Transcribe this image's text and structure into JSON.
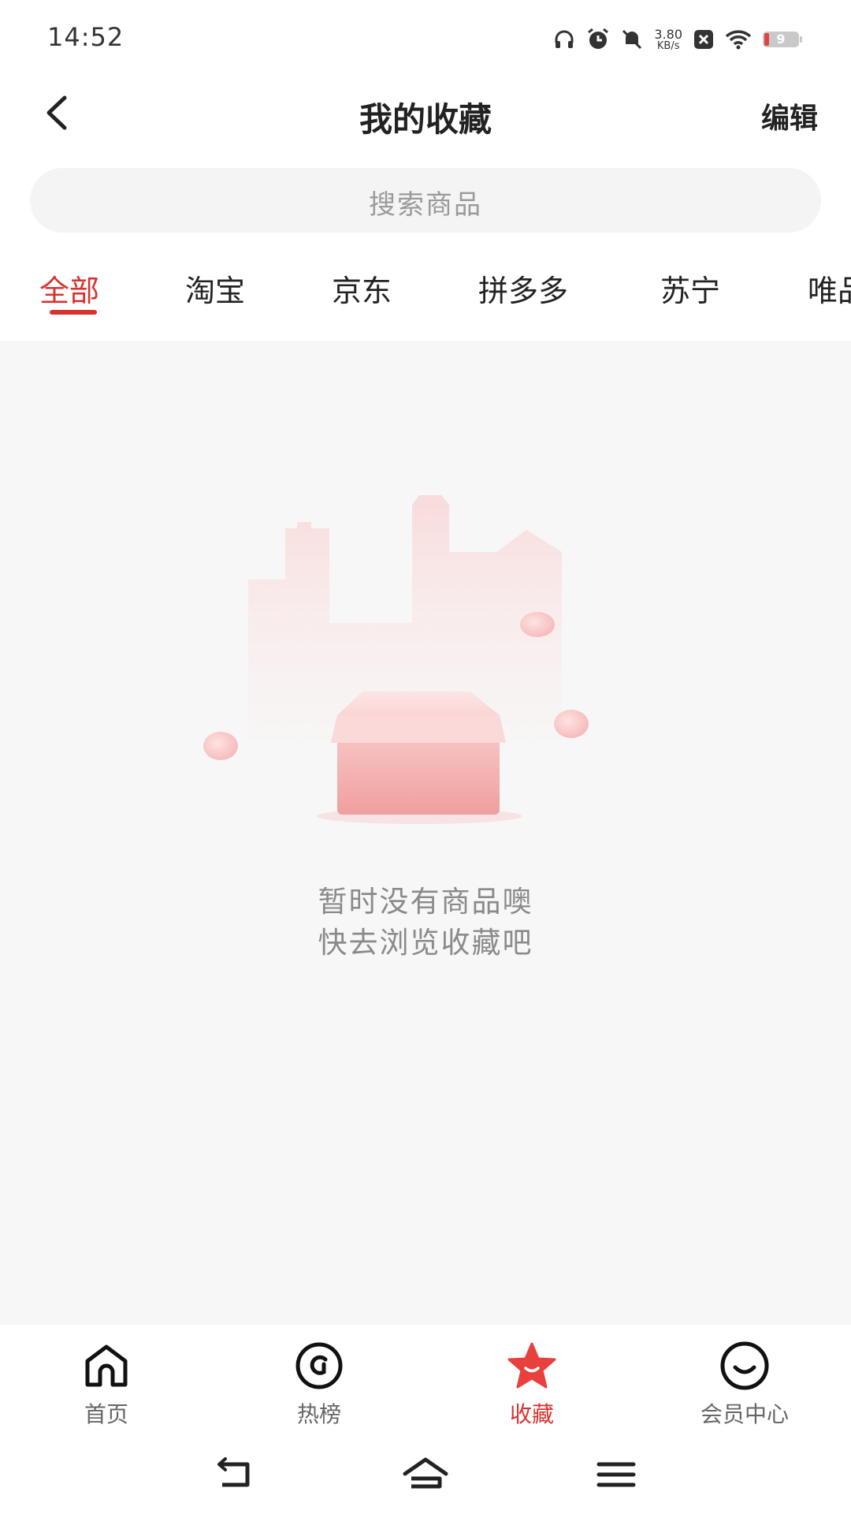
{
  "status_bar": {
    "time": "14:52",
    "net_speed_value": "3.80",
    "net_speed_unit": "KB/s",
    "battery_level": "9",
    "icons": [
      "headphones-icon",
      "alarm-icon",
      "mute-icon",
      "close-icon",
      "wifi-icon",
      "battery-icon"
    ]
  },
  "header": {
    "title": "我的收藏",
    "edit_label": "编辑",
    "back_icon": "chevron-left-icon"
  },
  "search": {
    "placeholder": "搜索商品"
  },
  "tabs": [
    {
      "label": "全部",
      "active": true
    },
    {
      "label": "淘宝",
      "active": false
    },
    {
      "label": "京东",
      "active": false
    },
    {
      "label": "拼多多",
      "active": false
    },
    {
      "label": "苏宁",
      "active": false
    },
    {
      "label": "唯品",
      "active": false
    }
  ],
  "empty_state": {
    "line1": "暂时没有商品噢",
    "line2": "快去浏览收藏吧",
    "illustration": "empty-box-city-illustration"
  },
  "bottom_nav": [
    {
      "label": "首页",
      "icon": "home-icon",
      "active": false
    },
    {
      "label": "热榜",
      "icon": "hot-list-icon",
      "active": false
    },
    {
      "label": "收藏",
      "icon": "star-icon",
      "active": true
    },
    {
      "label": "会员中心",
      "icon": "smile-icon",
      "active": false
    }
  ],
  "colors": {
    "accent": "#d8322f",
    "background": "#f7f7f7",
    "search_bg": "#f4f4f4"
  }
}
